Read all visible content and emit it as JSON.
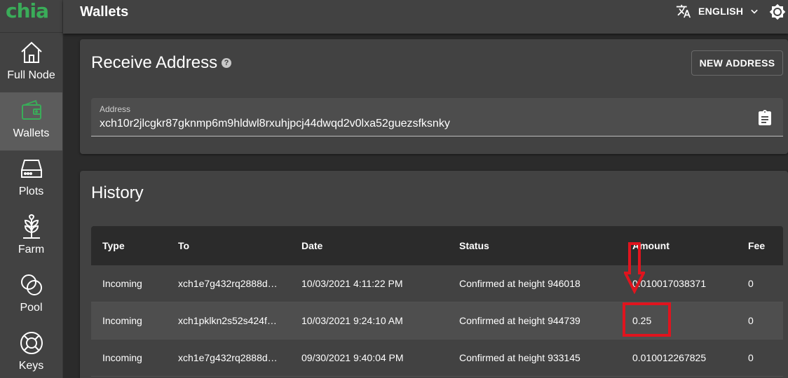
{
  "app": {
    "logo": "chia",
    "page_title": "Wallets"
  },
  "sidebar": {
    "items": [
      {
        "label": "Full Node",
        "icon": "home-icon",
        "active": false
      },
      {
        "label": "Wallets",
        "icon": "wallet-icon",
        "active": true
      },
      {
        "label": "Plots",
        "icon": "hard-drive-icon",
        "active": false
      },
      {
        "label": "Farm",
        "icon": "plant-icon",
        "active": false
      },
      {
        "label": "Pool",
        "icon": "pool-icon",
        "active": false
      },
      {
        "label": "Keys",
        "icon": "lifebuoy-icon",
        "active": false
      }
    ]
  },
  "topbar": {
    "language": "ENGLISH"
  },
  "receive": {
    "title": "Receive Address",
    "new_address_label": "NEW ADDRESS",
    "address_label": "Address",
    "address_value": "xch10r2jlcgkr87gknmp6m9hldwl8rxuhjpcj44dwqd2v0lxa52guezsfksnky"
  },
  "history": {
    "title": "History",
    "columns": [
      "Type",
      "To",
      "Date",
      "Status",
      "Amount",
      "Fee"
    ],
    "rows": [
      {
        "type": "Incoming",
        "to": "xch1e7g432rq2888d…",
        "date": "10/03/2021 4:11:22 PM",
        "status": "Confirmed at height 946018",
        "amount": "0.010017038371",
        "fee": "0"
      },
      {
        "type": "Incoming",
        "to": "xch1pklkn2s52s424f…",
        "date": "10/03/2021 9:24:10 AM",
        "status": "Confirmed at height 944739",
        "amount": "0.25",
        "fee": "0"
      },
      {
        "type": "Incoming",
        "to": "xch1e7g432rq2888d…",
        "date": "09/30/2021 9:40:04 PM",
        "status": "Confirmed at height 933145",
        "amount": "0.010012267825",
        "fee": "0"
      }
    ]
  },
  "colors": {
    "brand_green": "#3aac59",
    "annotation_red": "#e0141e"
  }
}
